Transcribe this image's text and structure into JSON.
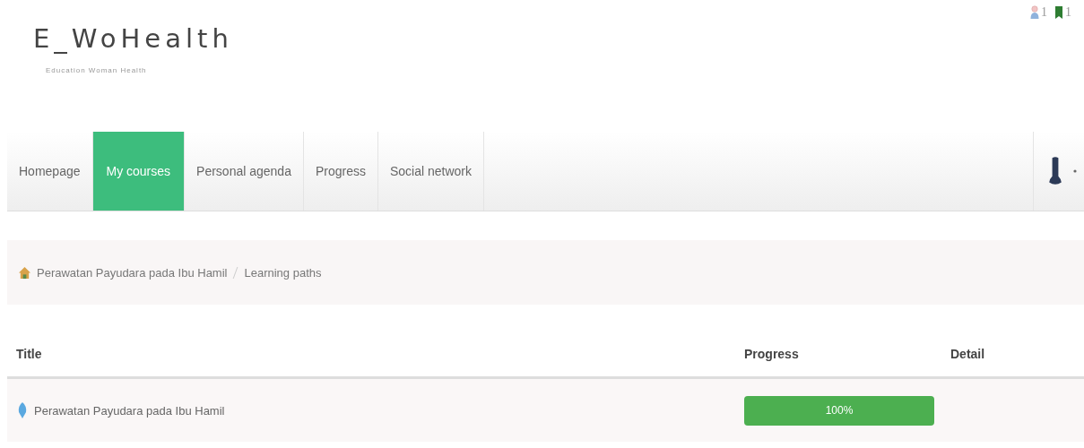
{
  "logo": {
    "title": "E_WoHealth",
    "subtitle": "Education Woman Health"
  },
  "header_counters": [
    {
      "kind": "user",
      "count": "1"
    },
    {
      "kind": "book",
      "count": "1"
    }
  ],
  "nav": {
    "tabs": [
      {
        "label": "Homepage",
        "selected": false
      },
      {
        "label": "My courses",
        "selected": true
      },
      {
        "label": "Personal agenda",
        "selected": false
      },
      {
        "label": "Progress",
        "selected": false
      },
      {
        "label": "Social network",
        "selected": false
      }
    ]
  },
  "breadcrumb": [
    "Perawatan Payudara pada Ibu Hamil",
    "Learning paths"
  ],
  "table": {
    "columns": [
      "Title",
      "Progress",
      "Detail"
    ],
    "rows": [
      {
        "title": "Perawatan Payudara pada Ibu Hamil",
        "level": 1,
        "progress": "100%"
      }
    ]
  }
}
